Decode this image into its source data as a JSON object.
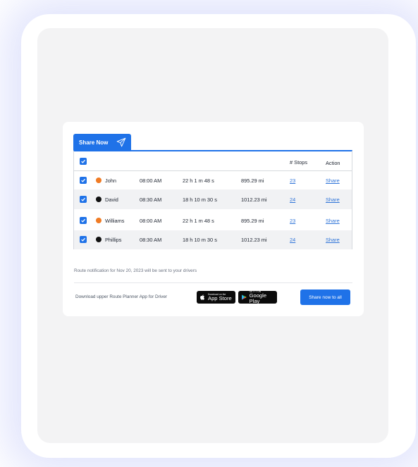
{
  "tab": {
    "label": "Share Now"
  },
  "table": {
    "headers": {
      "stops": "# Stops",
      "action": "Action"
    },
    "rows": [
      {
        "name": "John",
        "dot_color": "#f07b24",
        "time": "08:00 AM",
        "duration": "22 h 1 m 48 s",
        "distance": "895.29 mi",
        "stops": "23",
        "action": "Share"
      },
      {
        "name": "David",
        "dot_color": "#111111",
        "time": "08:30 AM",
        "duration": "18 h 10 m 30 s",
        "distance": "1012.23 mi",
        "stops": "24",
        "action": "Share"
      },
      {
        "name": "Williams",
        "dot_color": "#f07b24",
        "time": "08:00 AM",
        "duration": "22 h 1 m 48 s",
        "distance": "895.29 mi",
        "stops": "23",
        "action": "Share"
      },
      {
        "name": "Phillips",
        "dot_color": "#111111",
        "time": "08:30 AM",
        "duration": "18 h 10 m 30 s",
        "distance": "1012.23 mi",
        "stops": "24",
        "action": "Share"
      }
    ]
  },
  "notice": "Route notification for Nov 20, 2023 will be sent to your drivers",
  "footer": {
    "download_text": "Download upper Route Planner App for Driver",
    "app_store_small": "Download on the",
    "app_store_big": "App Store",
    "google_play_small": "GET IT ON",
    "google_play_big": "Google Play",
    "share_all_label": "Share now to all"
  },
  "colors": {
    "accent": "#1f72e8",
    "link": "#2f74d8"
  },
  "icons": {
    "tab": "send-icon",
    "checkbox": "check-icon",
    "app_store": "apple-icon",
    "google_play": "google-play-icon"
  }
}
